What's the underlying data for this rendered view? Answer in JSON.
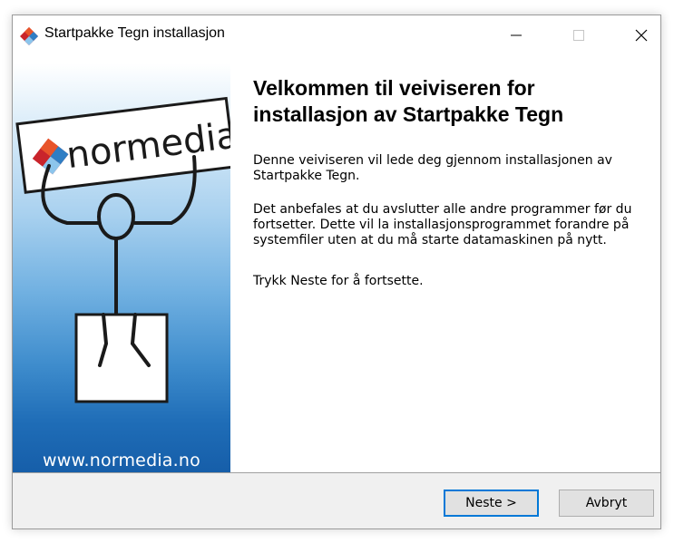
{
  "window": {
    "title": "Startpakke Tegn installasjon",
    "icon": "installer-diamond-icon",
    "controls": [
      "minimize-icon",
      "maximize-icon",
      "close-icon"
    ]
  },
  "sidebar": {
    "logo_text": "normedia",
    "logo_icon": "normedia-diamond-logo",
    "illustration": "stick-figure-holding-sign",
    "url": "www.normedia.no"
  },
  "content": {
    "heading": "Velkommen til veiviseren for installasjon av Startpakke Tegn",
    "paragraphs": [
      "Denne veiviseren vil lede deg gjennom installasjonen av Startpakke Tegn.",
      "Det anbefales at du avslutter alle andre programmer før du fortsetter. Dette vil la installasjonsprogrammet forandre på systemfiler uten at du må starte datamaskinen på nytt.",
      "Trykk Neste for å fortsette."
    ]
  },
  "footer": {
    "next_label": "Neste >",
    "cancel_label": "Avbryt"
  },
  "colors": {
    "accent": "#0078d7",
    "sidebar_bottom": "#165ea9",
    "logo_orange": "#e8542a",
    "logo_red": "#c9242b",
    "logo_blue": "#2f7ec4",
    "logo_light_blue": "#8cc5ec"
  }
}
